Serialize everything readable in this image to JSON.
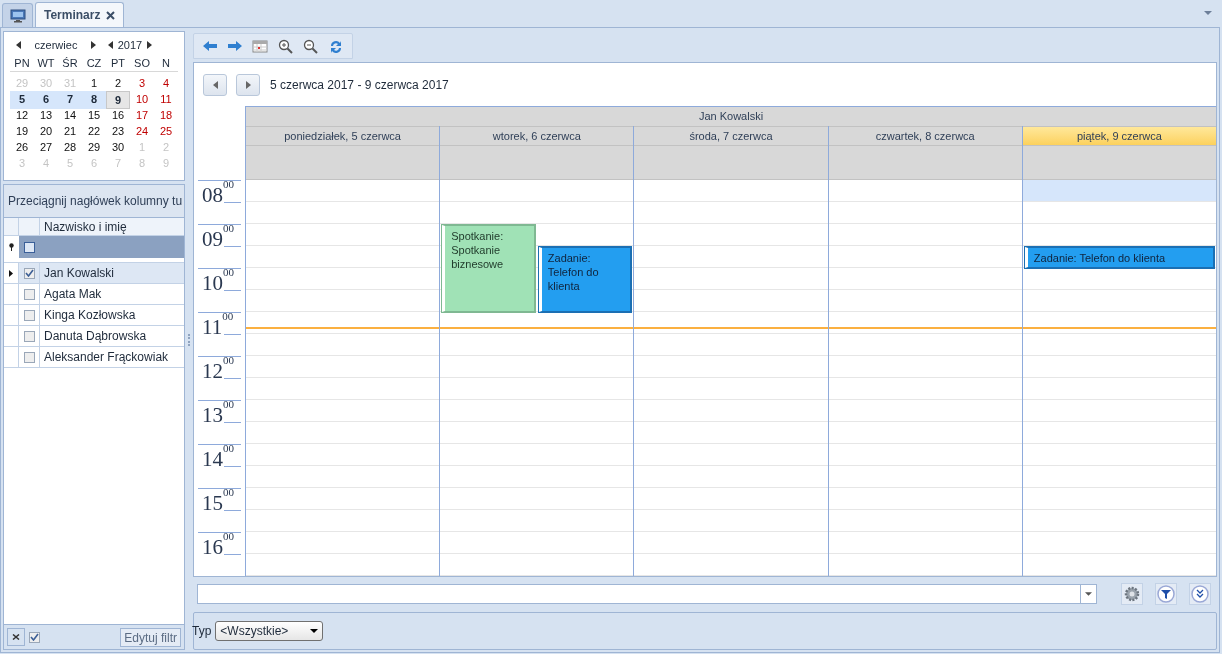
{
  "tabs": [
    {
      "kind": "home",
      "selected": false
    },
    {
      "kind": "doc",
      "title": "Terminarz",
      "selected": true
    }
  ],
  "mini_calendar": {
    "month": "czerwiec",
    "year": "2017",
    "weekdays": [
      "PN",
      "WT",
      "ŚR",
      "CZ",
      "PT",
      "SO",
      "N"
    ],
    "weeks": [
      [
        {
          "day": "29",
          "kind": "other"
        },
        {
          "day": "30",
          "kind": "other"
        },
        {
          "day": "31",
          "kind": "other"
        },
        {
          "day": "1",
          "kind": "normal"
        },
        {
          "day": "2",
          "kind": "normal"
        },
        {
          "day": "3",
          "kind": "weekend"
        },
        {
          "day": "4",
          "kind": "weekend"
        }
      ],
      [
        {
          "day": "5",
          "kind": "selected"
        },
        {
          "day": "6",
          "kind": "selected"
        },
        {
          "day": "7",
          "kind": "selected"
        },
        {
          "day": "8",
          "kind": "selected"
        },
        {
          "day": "9",
          "kind": "today"
        },
        {
          "day": "10",
          "kind": "weekend"
        },
        {
          "day": "11",
          "kind": "weekend"
        }
      ],
      [
        {
          "day": "12",
          "kind": "normal"
        },
        {
          "day": "13",
          "kind": "normal"
        },
        {
          "day": "14",
          "kind": "normal"
        },
        {
          "day": "15",
          "kind": "normal"
        },
        {
          "day": "16",
          "kind": "normal"
        },
        {
          "day": "17",
          "kind": "weekend"
        },
        {
          "day": "18",
          "kind": "weekend"
        }
      ],
      [
        {
          "day": "19",
          "kind": "normal"
        },
        {
          "day": "20",
          "kind": "normal"
        },
        {
          "day": "21",
          "kind": "normal"
        },
        {
          "day": "22",
          "kind": "normal"
        },
        {
          "day": "23",
          "kind": "normal"
        },
        {
          "day": "24",
          "kind": "weekend"
        },
        {
          "day": "25",
          "kind": "weekend"
        }
      ],
      [
        {
          "day": "26",
          "kind": "normal"
        },
        {
          "day": "27",
          "kind": "normal"
        },
        {
          "day": "28",
          "kind": "normal"
        },
        {
          "day": "29",
          "kind": "normal"
        },
        {
          "day": "30",
          "kind": "normal"
        },
        {
          "day": "1",
          "kind": "other"
        },
        {
          "day": "2",
          "kind": "other"
        }
      ],
      [
        {
          "day": "3",
          "kind": "other"
        },
        {
          "day": "4",
          "kind": "other"
        },
        {
          "day": "5",
          "kind": "other"
        },
        {
          "day": "6",
          "kind": "other"
        },
        {
          "day": "7",
          "kind": "other"
        },
        {
          "day": "8",
          "kind": "other"
        },
        {
          "day": "9",
          "kind": "other"
        }
      ]
    ]
  },
  "employees": {
    "group_panel": "Przeciągnij nagłówek kolumny tu",
    "column": "Nazwisko i imię",
    "filter_checked": false,
    "rows": [
      {
        "name": "Jan Kowalski",
        "checked": true,
        "selected": true
      },
      {
        "name": "Agata Mak",
        "checked": false,
        "selected": false
      },
      {
        "name": "Kinga Kozłowska",
        "checked": false,
        "selected": false
      },
      {
        "name": "Danuta Dąbrowska",
        "checked": false,
        "selected": false
      },
      {
        "name": "Aleksander Frąckowiak",
        "checked": false,
        "selected": false
      }
    ],
    "filter_enabled": true,
    "edit_filter": "Edytuj filtr"
  },
  "scheduler": {
    "range": "5 czerwca 2017 - 9 czerwca 2017",
    "resource": "Jan Kowalski",
    "now_slots": [
      false,
      false,
      false,
      false,
      false,
      false,
      true,
      false,
      false,
      false,
      false,
      false,
      false,
      false,
      false,
      false,
      false,
      false
    ],
    "hours": [
      "08$^{00}$",
      "09$^{00}$",
      "10$^{00}$",
      "11$^{00}$",
      "12$^{00}$",
      "13$^{00}$",
      "14$^{00}$",
      "15$^{00}$",
      "16$^{00}$"
    ],
    "days": [
      {
        "label": "poniedziałek, 5 czerwca",
        "today": false,
        "slots": [
          {
            "selected": false
          },
          {
            "selected": false
          },
          {
            "selected": false
          },
          {
            "selected": false
          },
          {
            "selected": false
          },
          {
            "selected": false
          },
          {
            "selected": false
          },
          {
            "selected": false
          },
          {
            "selected": false
          },
          {
            "selected": false
          },
          {
            "selected": false
          },
          {
            "selected": false
          },
          {
            "selected": false
          },
          {
            "selected": false
          },
          {
            "selected": false
          },
          {
            "selected": false
          },
          {
            "selected": false
          },
          {
            "selected": false
          }
        ]
      },
      {
        "label": "wtorek, 6 czerwca",
        "today": false,
        "slots": [
          {
            "selected": false
          },
          {
            "selected": false
          },
          {
            "selected": false,
            "events": [
              {
                "kind": "meeting",
                "text": "Spotkanie: Spotkanie biznesowe",
                "span": [
                  true,
                  true,
                  true,
                  true
                ]
              }
            ]
          },
          {
            "selected": false,
            "events": [
              {
                "kind": "task",
                "text": "Zadanie: Telefon do klienta",
                "span": [
                  true,
                  true,
                  true
                ]
              }
            ]
          },
          {
            "selected": false
          },
          {
            "selected": false
          },
          {
            "selected": false
          },
          {
            "selected": false
          },
          {
            "selected": false
          },
          {
            "selected": false
          },
          {
            "selected": false
          },
          {
            "selected": false
          },
          {
            "selected": false
          },
          {
            "selected": false
          },
          {
            "selected": false
          },
          {
            "selected": false
          },
          {
            "selected": false
          },
          {
            "selected": false
          }
        ]
      },
      {
        "label": "środa, 7 czerwca",
        "today": false,
        "slots": [
          {
            "selected": false
          },
          {
            "selected": false
          },
          {
            "selected": false
          },
          {
            "selected": false
          },
          {
            "selected": false
          },
          {
            "selected": false
          },
          {
            "selected": false
          },
          {
            "selected": false
          },
          {
            "selected": false
          },
          {
            "selected": false
          },
          {
            "selected": false
          },
          {
            "selected": false
          },
          {
            "selected": false
          },
          {
            "selected": false
          },
          {
            "selected": false
          },
          {
            "selected": false
          },
          {
            "selected": false
          },
          {
            "selected": false
          }
        ]
      },
      {
        "label": "czwartek, 8 czerwca",
        "today": false,
        "slots": [
          {
            "selected": false
          },
          {
            "selected": false
          },
          {
            "selected": false
          },
          {
            "selected": false
          },
          {
            "selected": false
          },
          {
            "selected": false
          },
          {
            "selected": false
          },
          {
            "selected": false
          },
          {
            "selected": false
          },
          {
            "selected": false
          },
          {
            "selected": false
          },
          {
            "selected": false
          },
          {
            "selected": false
          },
          {
            "selected": false
          },
          {
            "selected": false
          },
          {
            "selected": false
          },
          {
            "selected": false
          },
          {
            "selected": false
          }
        ]
      },
      {
        "label": "piątek, 9 czerwca",
        "today": true,
        "slots": [
          {
            "selected": true
          },
          {
            "selected": false
          },
          {
            "selected": false
          },
          {
            "selected": false,
            "events": [
              {
                "kind": "task",
                "text": "Zadanie: Telefon do klienta",
                "span": [
                  true
                ]
              }
            ]
          },
          {
            "selected": false
          },
          {
            "selected": false
          },
          {
            "selected": false
          },
          {
            "selected": false
          },
          {
            "selected": false
          },
          {
            "selected": false
          },
          {
            "selected": false
          },
          {
            "selected": false
          },
          {
            "selected": false
          },
          {
            "selected": false
          },
          {
            "selected": false
          },
          {
            "selected": false
          },
          {
            "selected": false
          },
          {
            "selected": false
          }
        ]
      }
    ]
  },
  "filter": {
    "type_label": "Typ",
    "type_value": "<Wszystkie>"
  }
}
